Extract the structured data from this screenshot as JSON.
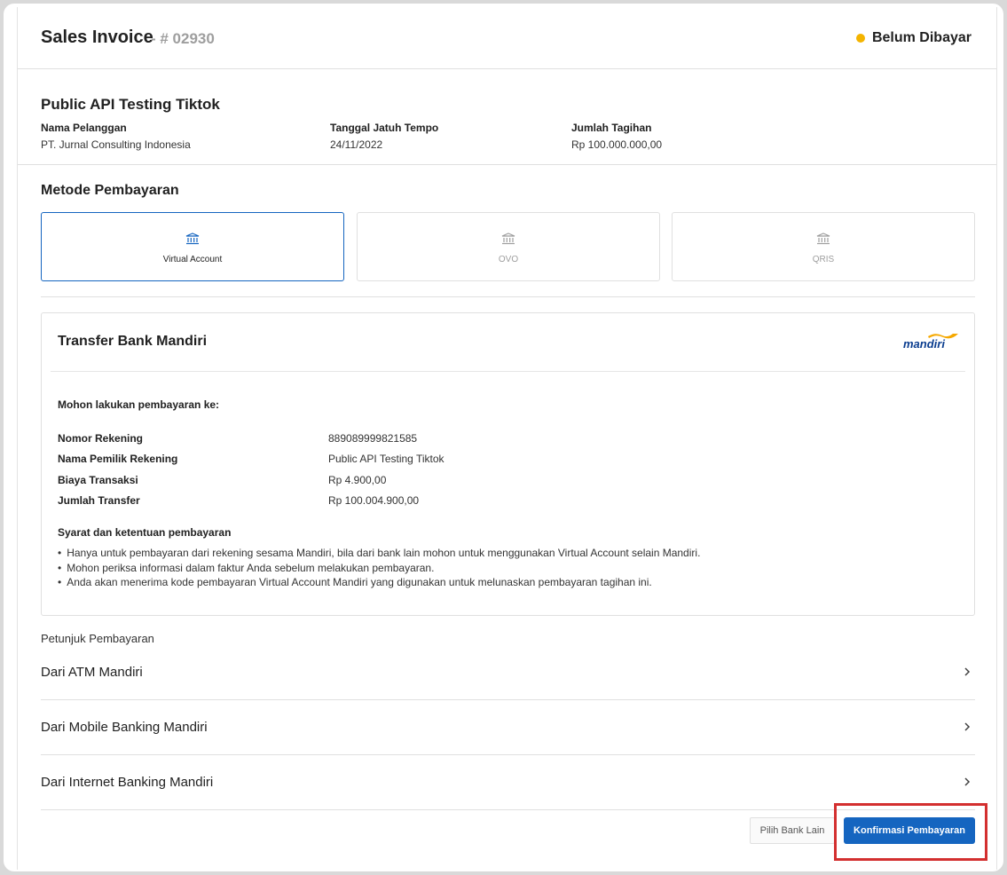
{
  "header": {
    "title": "Sales Invoice",
    "invoice_number": "- # 02930",
    "status": "Belum Dibayar",
    "status_color": "#f4b400"
  },
  "customer": {
    "name": "Public API Testing Tiktok",
    "fields": [
      {
        "label": "Nama Pelanggan",
        "value": "PT. Jurnal Consulting Indonesia"
      },
      {
        "label": "Tanggal Jatuh Tempo",
        "value": "24/11/2022"
      },
      {
        "label": "Jumlah Tagihan",
        "value": "Rp 100.000.000,00"
      }
    ]
  },
  "payment_methods": {
    "title": "Metode Pembayaran",
    "options": [
      {
        "label": "Virtual Account",
        "icon": "bank-icon",
        "selected": true
      },
      {
        "label": "OVO",
        "icon": "bank-icon",
        "selected": false
      },
      {
        "label": "QRIS",
        "icon": "bank-icon",
        "selected": false
      }
    ]
  },
  "bank_transfer": {
    "title": "Transfer Bank Mandiri",
    "logo_text": "mandiri",
    "request_text": "Mohon lakukan pembayaran ke:",
    "details": [
      {
        "label": "Nomor Rekening",
        "value": "889089999821585"
      },
      {
        "label": "Nama Pemilik Rekening",
        "value": "Public API Testing Tiktok"
      },
      {
        "label": "Biaya Transaksi",
        "value": "Rp 4.900,00"
      },
      {
        "label": "Jumlah Transfer",
        "value": "Rp 100.004.900,00"
      }
    ],
    "terms_title": "Syarat dan ketentuan pembayaran",
    "terms": [
      "Hanya untuk pembayaran dari rekening sesama Mandiri, bila dari bank lain mohon untuk menggunakan Virtual Account selain Mandiri.",
      "Mohon periksa informasi dalam faktur Anda sebelum melakukan pembayaran.",
      "Anda akan menerima kode pembayaran Virtual Account Mandiri yang digunakan untuk melunaskan pembayaran tagihan ini."
    ]
  },
  "guide": {
    "title": "Petunjuk Pembayaran",
    "items": [
      {
        "label": "Dari ATM Mandiri"
      },
      {
        "label": "Dari Mobile Banking Mandiri"
      },
      {
        "label": "Dari Internet Banking Mandiri"
      }
    ]
  },
  "actions": {
    "secondary_label": "Pilih Bank Lain",
    "primary_label": "Konfirmasi Pembayaran"
  },
  "colors": {
    "accent": "#1565c0",
    "highlight": "#d32f2f"
  }
}
